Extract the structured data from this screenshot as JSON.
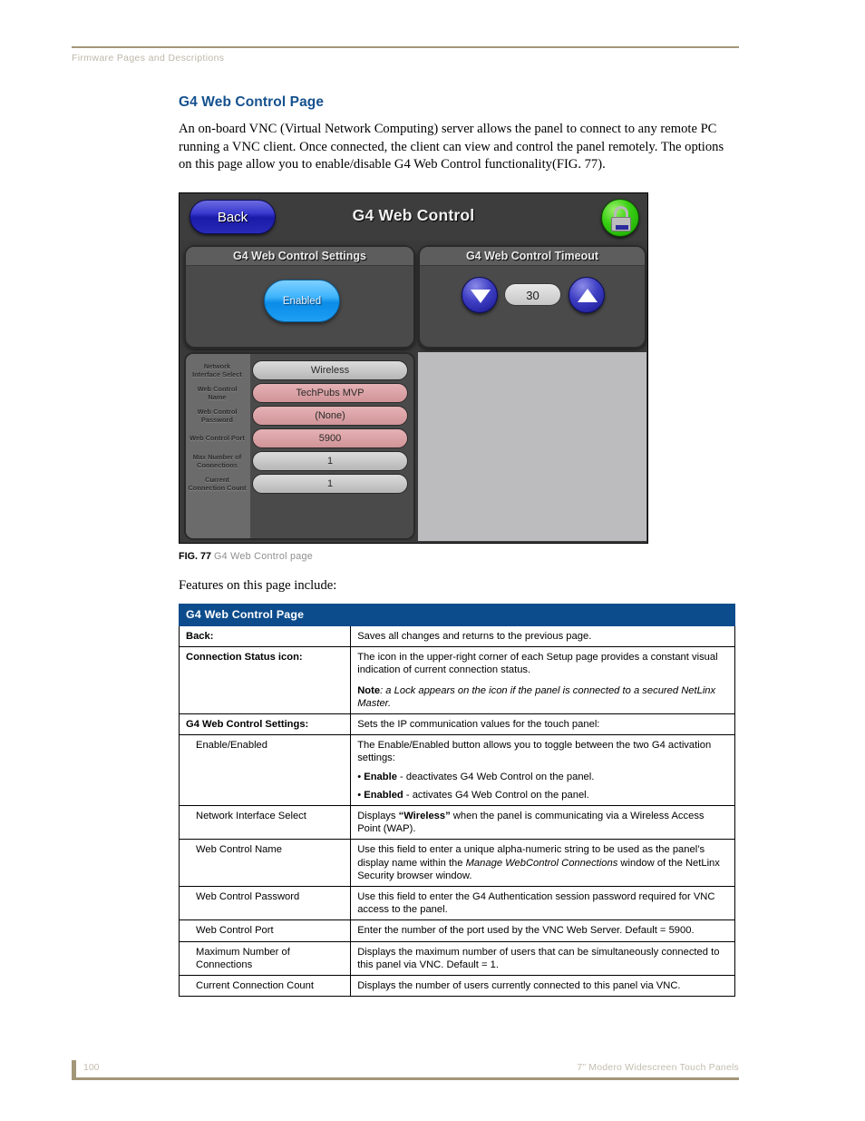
{
  "header": {
    "running_head": "Firmware Pages and Descriptions"
  },
  "section": {
    "title": "G4 Web Control Page",
    "intro": "An on-board VNC (Virtual Network Computing) server allows the panel to connect to any remote PC running a VNC client. Once connected, the client can view and control the panel remotely. The options on this page allow you to enable/disable G4 Web Control functionality(FIG. 77)."
  },
  "device": {
    "title": "G4 Web Control",
    "back_label": "Back",
    "lock_icon": "green-lock-icon",
    "settings_group_title": "G4 Web Control Settings",
    "timeout_group_title": "G4 Web Control Timeout",
    "enable_button_label": "Enabled",
    "timeout_value": "30",
    "down_icon": "triangle-down-icon",
    "up_icon": "triangle-up-icon",
    "fields": [
      {
        "label": "Network\nInterface Select",
        "label_line1": "Network",
        "label_line2": "Interface Select",
        "value": "Wireless",
        "style": "gray"
      },
      {
        "label": "Web Control Name",
        "label_line1": "Web Control",
        "label_line2": "Name",
        "value": "TechPubs MVP",
        "style": "pink"
      },
      {
        "label": "Web Control Password",
        "label_line1": "Web Control",
        "label_line2": "Password",
        "value": "(None)",
        "style": "pink"
      },
      {
        "label": "Web Control Port",
        "label_line1": "Web Control Port",
        "label_line2": "",
        "value": "5900",
        "style": "pink"
      },
      {
        "label": "Max Number of Connections",
        "label_line1": "Max Number of",
        "label_line2": "Connections",
        "value": "1",
        "style": "gray"
      },
      {
        "label": "Current Connection Count",
        "label_line1": "Current",
        "label_line2": "Connection Count",
        "value": "1",
        "style": "gray"
      }
    ]
  },
  "figure": {
    "number": "FIG. 77",
    "description": "G4 Web Control page"
  },
  "features_intro": "Features on this page include:",
  "table": {
    "header": "G4 Web Control Page",
    "rows": {
      "back_label": "Back:",
      "back_desc": "Saves all changes and returns to the previous page.",
      "conn_label": "Connection Status icon:",
      "conn_desc": "The icon in the upper-right corner of each Setup page provides a constant visual indication of current connection status.",
      "conn_note_prefix": "Note",
      "conn_note_text": ": a Lock appears on the icon if the panel is connected to a secured NetLinx Master.",
      "settings_label": "G4 Web Control Settings:",
      "settings_desc": "Sets the IP communication values for the touch panel:",
      "enable_label": "Enable/Enabled",
      "enable_desc": "The Enable/Enabled button allows you to toggle between the two G4 activation settings:",
      "enable_bullet1_bold": "Enable",
      "enable_bullet1_rest": " - deactivates G4 Web Control on the panel.",
      "enable_bullet2_bold": "Enabled",
      "enable_bullet2_rest": " - activates G4 Web Control on the panel.",
      "nis_label": "Network Interface Select",
      "nis_desc_pre": "Displays ",
      "nis_desc_bold": "“Wireless”",
      "nis_desc_post": " when the panel is communicating via a Wireless Access Point (WAP).",
      "wcn_label": "Web Control Name",
      "wcn_desc_pre": "Use this field to enter a unique alpha-numeric string to be used as the panel’s display name within the ",
      "wcn_desc_italic": "Manage WebControl Connections",
      "wcn_desc_post": " window of the NetLinx Security browser window.",
      "wcp_label": "Web Control Password",
      "wcp_desc": "Use this field to enter the G4 Authentication session password required for VNC access to the panel.",
      "wcport_label": "Web Control Port",
      "wcport_desc": "Enter the number of the port used by the VNC Web Server. Default = 5900.",
      "maxconn_label": "Maximum Number of Connections",
      "maxconn_desc": "Displays the maximum number of users that can be simultaneously connected to this panel via VNC. Default = 1.",
      "curconn_label": "Current Connection Count",
      "curconn_desc": "Displays the number of users currently connected to this panel via VNC."
    }
  },
  "footer": {
    "page_number": "100",
    "doc_title": "7” Modero Widescreen Touch Panels"
  },
  "colors": {
    "accent_blue": "#15518f",
    "table_header_blue": "#0d4c8c",
    "rule_tan": "#a39779",
    "muted_text": "#c3bdaf"
  }
}
